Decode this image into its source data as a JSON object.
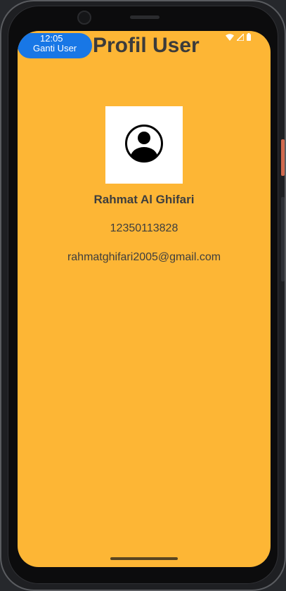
{
  "status_bar": {
    "time": "12:05",
    "icons": [
      "wifi-icon",
      "signal-icon",
      "battery-icon"
    ]
  },
  "header": {
    "switch_user_label": "Ganti User",
    "title": "Profil User"
  },
  "profile": {
    "avatar_icon": "account-circle-icon",
    "name": "Rahmat Al Ghifari",
    "id_number": "12350113828",
    "email": "rahmatghifari2005@gmail.com"
  },
  "colors": {
    "background": "#fdb635",
    "button": "#1877e6",
    "text": "#3e3e3e"
  }
}
